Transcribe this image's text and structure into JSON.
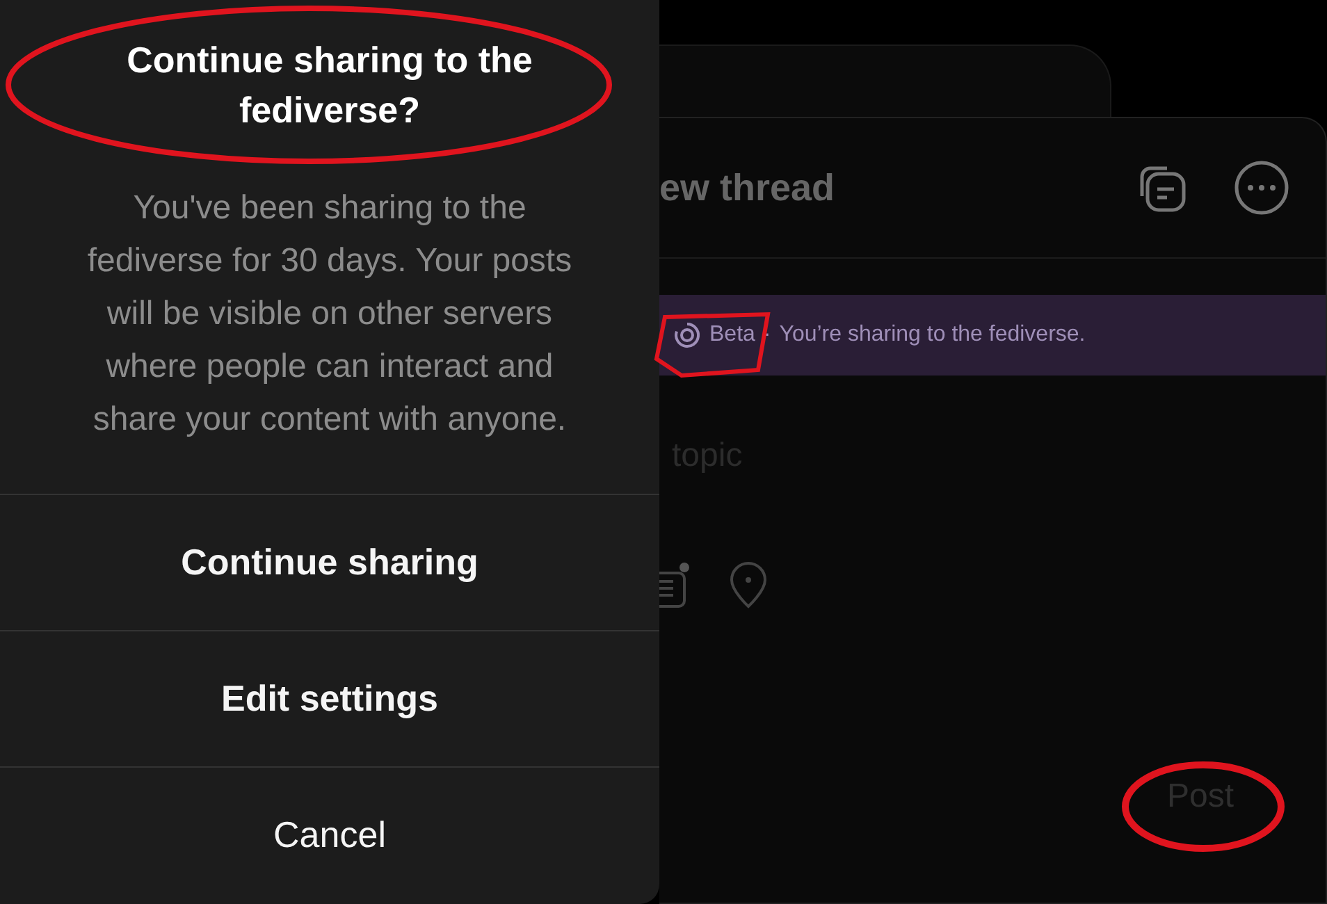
{
  "dialog": {
    "title": "Continue sharing to the fediverse?",
    "message": "You've been sharing to the fediverse for 30 days. Your posts will be visible on other servers where people can interact and share your content with anyone.",
    "actions": [
      {
        "label": "Continue sharing",
        "kind": "strong"
      },
      {
        "label": "Edit settings",
        "kind": "strong"
      },
      {
        "label": "Cancel",
        "kind": "plain"
      }
    ]
  },
  "composer": {
    "title": "ew thread",
    "banner": {
      "badge": "Beta",
      "separator": "·",
      "text": "You’re sharing to the fediverse."
    },
    "topic_placeholder": "topic",
    "post_button": {
      "label": "Post",
      "disabled": true
    }
  }
}
